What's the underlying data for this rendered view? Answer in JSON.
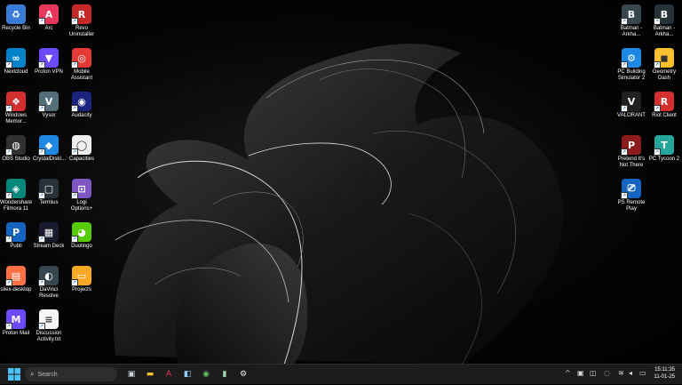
{
  "desktop_icons_left": [
    {
      "label": "Recycle Bin",
      "icon": "recycle-bin-icon",
      "color": "#3a7bd5",
      "glyph": "♻"
    },
    {
      "label": "Arc",
      "icon": "arc-icon",
      "color": "#e8365d",
      "glyph": "A"
    },
    {
      "label": "Revo Uninstaller",
      "icon": "revo-uninstaller-icon",
      "color": "#c62828",
      "glyph": "R"
    },
    {
      "label": "Nextcloud",
      "icon": "nextcloud-icon",
      "color": "#0082c9",
      "glyph": "∞"
    },
    {
      "label": "Proton VPN",
      "icon": "proton-vpn-icon",
      "color": "#6d4aff",
      "glyph": "▼"
    },
    {
      "label": "Mobile Assistant",
      "icon": "mobile-assistant-icon",
      "color": "#e53935",
      "glyph": "◎"
    },
    {
      "label": "Windows Memor...",
      "icon": "windows-memory-icon",
      "color": "#d32f2f",
      "glyph": "❖"
    },
    {
      "label": "Vysor",
      "icon": "vysor-icon",
      "color": "#546e7a",
      "glyph": "V"
    },
    {
      "label": "Audacity",
      "icon": "audacity-icon",
      "color": "#1a237e",
      "glyph": "◉"
    },
    {
      "label": "OBS Studio",
      "icon": "obs-studio-icon",
      "color": "#303030",
      "glyph": "◍"
    },
    {
      "label": "CrystalDiskI...",
      "icon": "crystaldisk-icon",
      "color": "#1e88e5",
      "glyph": "◆"
    },
    {
      "label": "Capacities",
      "icon": "capacities-icon",
      "color": "#eeeeee",
      "glyph": "◯"
    },
    {
      "label": "Wondershare Filmora 11",
      "icon": "filmora-icon",
      "color": "#00897b",
      "glyph": "◈"
    },
    {
      "label": "Termius",
      "icon": "termius-icon",
      "color": "#263238",
      "glyph": "▢"
    },
    {
      "label": "Logi Options+",
      "icon": "logi-options-icon",
      "color": "#7e57c2",
      "glyph": "⊡"
    },
    {
      "label": "Publi",
      "icon": "publi-icon",
      "color": "#1565c0",
      "glyph": "P"
    },
    {
      "label": "Stream Deck",
      "icon": "stream-deck-icon",
      "color": "#1a1a2e",
      "glyph": "▦"
    },
    {
      "label": "Duolingo",
      "icon": "duolingo-icon",
      "color": "#58cc02",
      "glyph": "◕"
    },
    {
      "label": "sliex-desktop",
      "icon": "sliex-icon",
      "color": "#ff7043",
      "glyph": "▤"
    },
    {
      "label": "DaVinci Resolve",
      "icon": "davinci-resolve-icon",
      "color": "#37474f",
      "glyph": "◐"
    },
    {
      "label": "Projects",
      "icon": "folder-icon",
      "color": "#f9a825",
      "glyph": "▭"
    },
    {
      "label": "Proton Mail",
      "icon": "proton-mail-icon",
      "color": "#6d4aff",
      "glyph": "M"
    },
    {
      "label": "Discussion Activity.txt",
      "icon": "text-file-icon",
      "color": "#f5f5f5",
      "glyph": "≡"
    }
  ],
  "desktop_icons_right": [
    {
      "label": "Batman - Arkha...",
      "icon": "batman-arkham-icon",
      "color": "#37474f",
      "glyph": "B"
    },
    {
      "label": "Batman - Arkha...",
      "icon": "batman-arkham-2-icon",
      "color": "#263238",
      "glyph": "B"
    },
    {
      "label": "PC Building Simulator 2",
      "icon": "pc-building-icon",
      "color": "#1e88e5",
      "glyph": "⚙"
    },
    {
      "label": "Geometry Dash",
      "icon": "geometry-dash-icon",
      "color": "#fbc02d",
      "glyph": "◼"
    },
    {
      "label": "VALORANT",
      "icon": "valorant-icon",
      "color": "#212121",
      "glyph": "V"
    },
    {
      "label": "Riot Client",
      "icon": "riot-client-icon",
      "color": "#d32f2f",
      "glyph": "R"
    },
    {
      "label": "Pretend It's Not There",
      "icon": "pretend-icon",
      "color": "#8d1b1b",
      "glyph": "P"
    },
    {
      "label": "PC Tycoon 2",
      "icon": "pc-tycoon-icon",
      "color": "#26a69a",
      "glyph": "T"
    },
    {
      "label": "PS Remote Play",
      "icon": "ps-remote-play-icon",
      "color": "#1565c0",
      "glyph": "⎚"
    }
  ],
  "taskbar": {
    "search_placeholder": "Search",
    "apps": [
      {
        "icon": "task-view-icon",
        "glyph": "▣",
        "color": "#cfd8dc"
      },
      {
        "icon": "file-explorer-icon",
        "glyph": "▬",
        "color": "#fbc02d"
      },
      {
        "icon": "arc-taskbar-icon",
        "glyph": "A",
        "color": "#e8365d"
      },
      {
        "icon": "store-icon",
        "glyph": "◧",
        "color": "#90caf9"
      },
      {
        "icon": "app-green-icon",
        "glyph": "◉",
        "color": "#66bb6a"
      },
      {
        "icon": "notepad-icon",
        "glyph": "▮",
        "color": "#a5d6a7"
      },
      {
        "icon": "settings-icon",
        "glyph": "⚙",
        "color": "#eceff1"
      }
    ],
    "time": "15:11:35",
    "date": "11-01-25"
  }
}
